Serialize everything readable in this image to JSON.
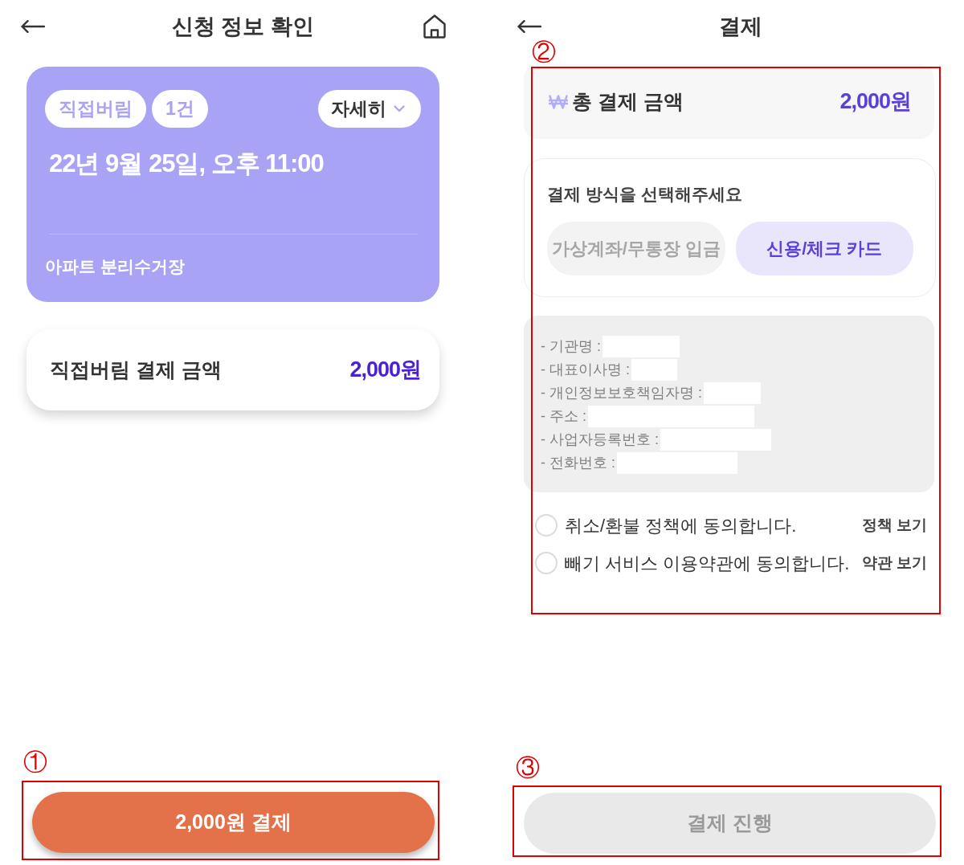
{
  "confirm_screen": {
    "title": "신청 정보 확인",
    "summary_card": {
      "tags": [
        "직접버림",
        "1건"
      ],
      "detail_button": "자세히",
      "datetime": "22년 9월 25일, 오후 11:00",
      "location": "아파트 분리수거장"
    },
    "amount_card": {
      "label": "직접버림 결제 금액",
      "amount": "2,000원"
    },
    "submit_button": {
      "label": "2,000원 결제",
      "disabled": false,
      "annotation": "①"
    }
  },
  "payment_screen": {
    "title": "결제",
    "annotation": "②",
    "total": {
      "label": "총 결제 금액",
      "amount": "2,000원"
    },
    "method": {
      "heading": "결제 방식을 선택해주세요",
      "options": [
        {
          "label": "가상계좌/무통장 입금",
          "selected": false
        },
        {
          "label": "신용/체크 카드",
          "selected": true
        }
      ]
    },
    "company_info": [
      {
        "label": "- 기관명 :",
        "redacted": true
      },
      {
        "label": "- 대표이사명 :",
        "redacted": true
      },
      {
        "label": "- 개인정보보호책임자명 :",
        "redacted": true
      },
      {
        "label": "- 주소 :",
        "redacted": true
      },
      {
        "label": "- 사업자등록번호 :",
        "redacted": true
      },
      {
        "label": "- 전화번호 :",
        "redacted": true
      }
    ],
    "agreements": [
      {
        "label": "취소/환불 정책에 동의합니다.",
        "link": "정책 보기",
        "checked": false
      },
      {
        "label": "빼기 서비스 이용약관에 동의합니다.",
        "link": "약관 보기",
        "checked": false
      }
    ],
    "submit_button": {
      "label": "결제 진행",
      "disabled": true,
      "annotation": "③"
    }
  }
}
